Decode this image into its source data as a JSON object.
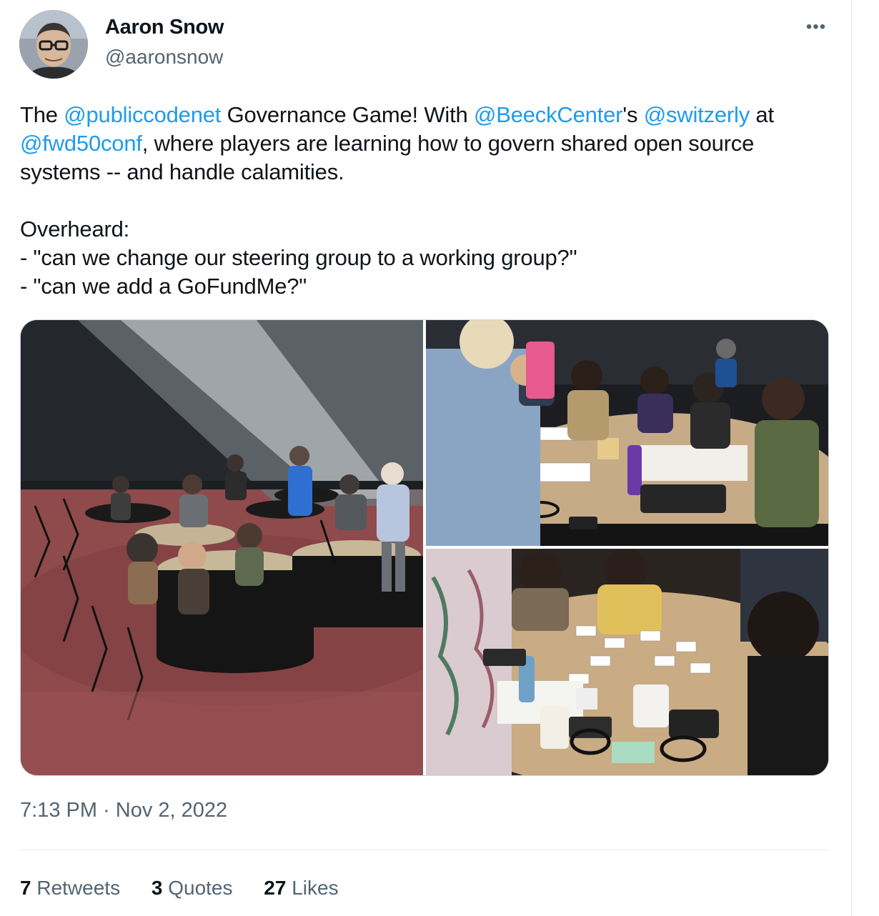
{
  "author": {
    "display_name": "Aaron Snow",
    "handle": "@aaronsnow",
    "avatar_icon": "profile-photo"
  },
  "more_icon_label": "•••",
  "tweet": {
    "segments": [
      {
        "text": "The ",
        "type": "text"
      },
      {
        "text": "@publiccodenet",
        "type": "mention"
      },
      {
        "text": " Governance Game! With ",
        "type": "text"
      },
      {
        "text": "@BeeckCenter",
        "type": "mention"
      },
      {
        "text": "'s ",
        "type": "text"
      },
      {
        "text": "@switzerly",
        "type": "mention"
      },
      {
        "text": " at ",
        "type": "text"
      },
      {
        "text": "@fwd50conf",
        "type": "mention"
      },
      {
        "text": ", where players are learning how to govern shared open source systems -- and handle calamities.",
        "type": "text"
      }
    ],
    "overheard_title": "Overheard:",
    "overheard_lines": [
      "- \"can we change our steering group to a working group?\"",
      "- \"can we add a GoFundMe?\""
    ]
  },
  "media": {
    "photos": [
      {
        "subject": "conference-hall-with-game-tables-photo"
      },
      {
        "subject": "players-around-table-photo"
      },
      {
        "subject": "cards-on-table-closeup-photo"
      }
    ]
  },
  "timestamp": "7:13 PM · Nov 2, 2022",
  "stats": [
    {
      "count": "7",
      "label": "Retweets"
    },
    {
      "count": "3",
      "label": "Quotes"
    },
    {
      "count": "27",
      "label": "Likes"
    }
  ],
  "colors": {
    "link": "#1d9bf0",
    "secondary_text": "#536471",
    "primary_text": "#0f1419",
    "divider": "#e6ecf0"
  }
}
